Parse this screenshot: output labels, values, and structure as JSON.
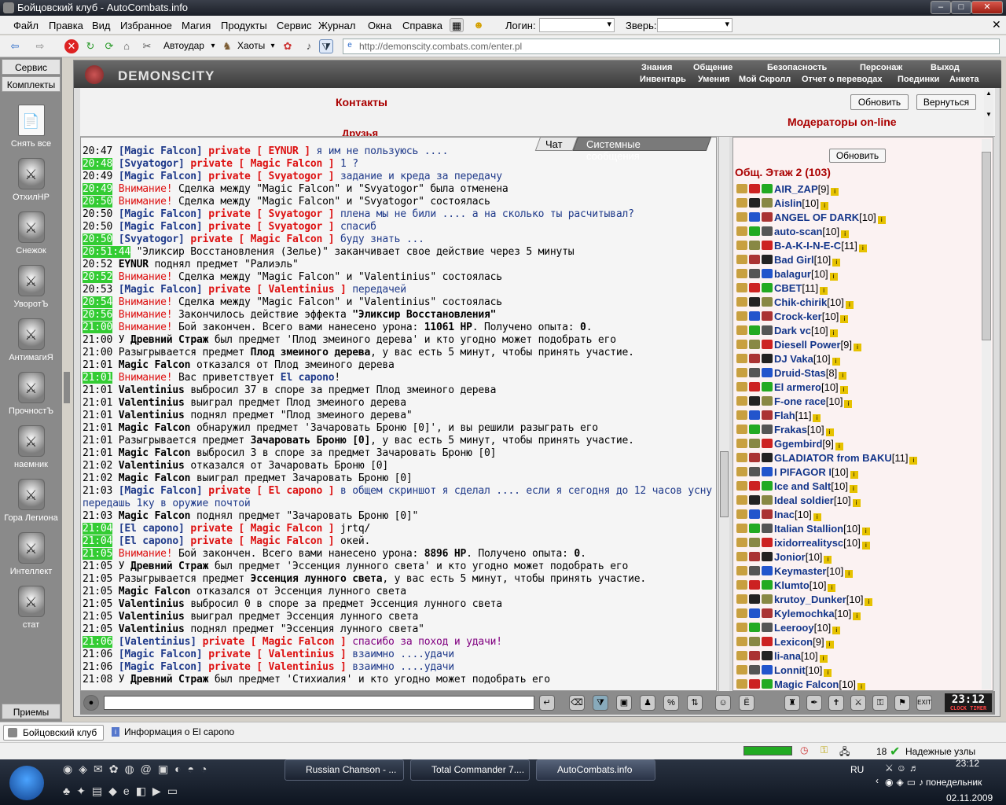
{
  "window": {
    "title": "Бойцовский клуб - AutoCombats.info"
  },
  "menu": {
    "items": [
      "Файл",
      "Правка",
      "Вид",
      "Избранное",
      "Магия",
      "Продукты",
      "Сервис",
      "Журнал",
      "Окна",
      "Справка"
    ],
    "login_label": "Логин:",
    "zver_label": "Зверь:"
  },
  "toolbar": {
    "autoudar": "Автоудар",
    "haoty": "Хаоты",
    "address": "http://demonscity.combats.com/enter.pl"
  },
  "left": {
    "tab1": "Сервис",
    "tab2": "Комплекты",
    "items": [
      "Снять все",
      "ОтхилНР",
      "Снежок",
      "УворотЪ",
      "АнтимагиЯ",
      "ПрочностЪ",
      "наемник",
      "Гора Легиона",
      "Интеллект",
      "стат"
    ],
    "bottom": "Приемы"
  },
  "header": {
    "logo": "DEMONSCITY",
    "nav_top": [
      "Знания",
      "Общение",
      "Безопасность",
      "Персонаж",
      "Выход"
    ],
    "nav_bottom": [
      "Инвентарь",
      "Умения",
      "Мой Скролл",
      "Отчет о переводах",
      "Поединки",
      "Анкета"
    ]
  },
  "contacts": {
    "title": "Контакты",
    "friends": "Друзья",
    "refresh": "Обновить",
    "back": "Вернуться",
    "moderators": "Модераторы on-line"
  },
  "chat_tabs": {
    "chat": "Чат",
    "system": "Системные сообщения"
  },
  "chat": [
    {
      "t": "20:47",
      "g": false,
      "parts": [
        [
          "nick",
          "[Magic Falcon]"
        ],
        [
          "priv",
          " private [ EYNUR ]"
        ],
        [
          "msg-priv",
          " я им не пользуюсь ...."
        ]
      ]
    },
    {
      "t": "20:48",
      "g": true,
      "parts": [
        [
          "nick",
          "[Svyatogor]"
        ],
        [
          "priv",
          " private [ Magic Falcon ]"
        ],
        [
          "msg-priv",
          " 1 ?"
        ]
      ]
    },
    {
      "t": "20:49",
      "g": false,
      "parts": [
        [
          "nick",
          "[Magic Falcon]"
        ],
        [
          "priv",
          " private [ Svyatogor ]"
        ],
        [
          "msg-priv",
          " задание и креда за передачу"
        ]
      ]
    },
    {
      "t": "20:49",
      "g": true,
      "parts": [
        [
          "warn",
          "Внимание!"
        ],
        [
          "msg-sys",
          " Сделка между \"Magic Falcon\" и \"Svyatogor\" была отменена"
        ]
      ]
    },
    {
      "t": "20:50",
      "g": true,
      "parts": [
        [
          "warn",
          "Внимание!"
        ],
        [
          "msg-sys",
          " Сделка между \"Magic Falcon\" и \"Svyatogor\" состоялась"
        ]
      ]
    },
    {
      "t": "20:50",
      "g": false,
      "parts": [
        [
          "nick",
          "[Magic Falcon]"
        ],
        [
          "priv",
          " private [ Svyatogor ]"
        ],
        [
          "msg-priv",
          " плена мы не били .... а на сколько ты расчитывал?"
        ]
      ]
    },
    {
      "t": "20:50",
      "g": false,
      "parts": [
        [
          "nick",
          "[Magic Falcon]"
        ],
        [
          "priv",
          " private [ Svyatogor ]"
        ],
        [
          "msg-priv",
          " спасиб"
        ]
      ]
    },
    {
      "t": "20:50",
      "g": true,
      "parts": [
        [
          "nick",
          "[Svyatogor]"
        ],
        [
          "priv",
          " private [ Magic Falcon ]"
        ],
        [
          "msg-priv",
          " буду знать ..."
        ]
      ]
    },
    {
      "t": "20:51:44",
      "g": true,
      "parts": [
        [
          "msg-sys",
          " \"Эликсир Восстановления (Зелье)\" заканчивает свое действие через 5 минуты"
        ]
      ]
    },
    {
      "t": "20:52",
      "g": false,
      "parts": [
        [
          "bold",
          "EYNUR"
        ],
        [
          "msg-sys",
          " поднял предмет \"Ралиэль\""
        ]
      ]
    },
    {
      "t": "20:52",
      "g": true,
      "parts": [
        [
          "warn",
          "Внимание!"
        ],
        [
          "msg-sys",
          " Сделка между \"Magic Falcon\" и \"Valentinius\" состоялась"
        ]
      ]
    },
    {
      "t": "20:53",
      "g": false,
      "parts": [
        [
          "nick",
          "[Magic Falcon]"
        ],
        [
          "priv",
          " private [ Valentinius ]"
        ],
        [
          "msg-priv",
          " передачей"
        ]
      ]
    },
    {
      "t": "20:54",
      "g": true,
      "parts": [
        [
          "warn",
          "Внимание!"
        ],
        [
          "msg-sys",
          " Сделка между \"Magic Falcon\" и \"Valentinius\" состоялась"
        ]
      ]
    },
    {
      "t": "20:56",
      "g": true,
      "parts": [
        [
          "warn",
          "Внимание!"
        ],
        [
          "msg-sys",
          " Закончилось действие эффекта "
        ],
        [
          "bold",
          "\"Эликсир Восстановления\""
        ]
      ]
    },
    {
      "t": "21:00",
      "g": true,
      "parts": [
        [
          "warn",
          "Внимание!"
        ],
        [
          "msg-sys",
          " Бой закончен. Всего вами нанесено урона: "
        ],
        [
          "bold",
          "11061 HP"
        ],
        [
          "msg-sys",
          ". Получено опыта: "
        ],
        [
          "bold",
          "0"
        ],
        [
          "msg-sys",
          "."
        ]
      ]
    },
    {
      "t": "21:00",
      "g": false,
      "parts": [
        [
          "msg-sys",
          "У "
        ],
        [
          "bold",
          "Древний Страж"
        ],
        [
          "msg-sys",
          " был предмет 'Плод змеиного дерева' и кто угодно может подобрать его"
        ]
      ]
    },
    {
      "t": "21:00",
      "g": false,
      "parts": [
        [
          "msg-sys",
          "Разыгрывается предмет "
        ],
        [
          "bold",
          "Плод змеиного дерева"
        ],
        [
          "msg-sys",
          ", у вас есть 5 минут, чтобы принять участие."
        ]
      ]
    },
    {
      "t": "21:01",
      "g": false,
      "parts": [
        [
          "bold",
          "Magic Falcon"
        ],
        [
          "msg-sys",
          " отказался от Плод змеиного дерева"
        ]
      ]
    },
    {
      "t": "21:01",
      "g": true,
      "parts": [
        [
          "warn",
          "Внимание!"
        ],
        [
          "msg-sys",
          " Вас приветствует "
        ],
        [
          "nick",
          "El capono"
        ],
        [
          "msg-sys",
          "!"
        ]
      ]
    },
    {
      "t": "21:01",
      "g": false,
      "parts": [
        [
          "bold",
          "Valentinius"
        ],
        [
          "msg-sys",
          " выбросил 37 в споре за предмет Плод змеиного дерева"
        ]
      ]
    },
    {
      "t": "21:01",
      "g": false,
      "parts": [
        [
          "bold",
          "Valentinius"
        ],
        [
          "msg-sys",
          " выиграл предмет Плод змеиного дерева"
        ]
      ]
    },
    {
      "t": "21:01",
      "g": false,
      "parts": [
        [
          "bold",
          "Valentinius"
        ],
        [
          "msg-sys",
          " поднял предмет \"Плод змеиного дерева\""
        ]
      ]
    },
    {
      "t": "21:01",
      "g": false,
      "parts": [
        [
          "bold",
          "Magic Falcon"
        ],
        [
          "msg-sys",
          " обнаружил предмет 'Зачаровать Броню [0]', и вы решили разыграть его"
        ]
      ]
    },
    {
      "t": "21:01",
      "g": false,
      "parts": [
        [
          "msg-sys",
          "Разыгрывается предмет "
        ],
        [
          "bold",
          "Зачаровать Броню [0]"
        ],
        [
          "msg-sys",
          ", у вас есть 5 минут, чтобы принять участие."
        ]
      ]
    },
    {
      "t": "21:01",
      "g": false,
      "parts": [
        [
          "bold",
          "Magic Falcon"
        ],
        [
          "msg-sys",
          " выбросил 3 в споре за предмет Зачаровать Броню [0]"
        ]
      ]
    },
    {
      "t": "21:02",
      "g": false,
      "parts": [
        [
          "bold",
          "Valentinius"
        ],
        [
          "msg-sys",
          " отказался от Зачаровать Броню [0]"
        ]
      ]
    },
    {
      "t": "21:02",
      "g": false,
      "parts": [
        [
          "bold",
          "Magic Falcon"
        ],
        [
          "msg-sys",
          " выиграл предмет Зачаровать Броню [0]"
        ]
      ]
    },
    {
      "t": "21:03",
      "g": false,
      "parts": [
        [
          "nick",
          "[Magic Falcon]"
        ],
        [
          "priv",
          " private [ El capono ]"
        ],
        [
          "msg-priv",
          " в общем скриншот я сделал .... если я сегодня до 12 часов усну"
        ]
      ]
    },
    {
      "t": "",
      "g": false,
      "parts": [
        [
          "msg-priv",
          "передашь 1ку в оружие почтой"
        ]
      ]
    },
    {
      "t": "21:03",
      "g": false,
      "parts": [
        [
          "bold",
          "Magic Falcon"
        ],
        [
          "msg-sys",
          " поднял предмет \"Зачаровать Броню [0]\""
        ]
      ]
    },
    {
      "t": "21:04",
      "g": true,
      "parts": [
        [
          "nick",
          "[El capono]"
        ],
        [
          "priv",
          " private [ Magic Falcon ]"
        ],
        [
          "msg-sys",
          " jrtq/"
        ]
      ]
    },
    {
      "t": "21:04",
      "g": true,
      "parts": [
        [
          "nick",
          "[El capono]"
        ],
        [
          "priv",
          " private [ Magic Falcon ]"
        ],
        [
          "msg-sys",
          " окей."
        ]
      ]
    },
    {
      "t": "21:05",
      "g": true,
      "parts": [
        [
          "warn",
          "Внимание!"
        ],
        [
          "msg-sys",
          " Бой закончен. Всего вами нанесено урона: "
        ],
        [
          "bold",
          "8896 HP"
        ],
        [
          "msg-sys",
          ". Получено опыта: "
        ],
        [
          "bold",
          "0"
        ],
        [
          "msg-sys",
          "."
        ]
      ]
    },
    {
      "t": "21:05",
      "g": false,
      "parts": [
        [
          "msg-sys",
          "У "
        ],
        [
          "bold",
          "Древний Страж"
        ],
        [
          "msg-sys",
          " был предмет 'Эссенция лунного света' и кто угодно может подобрать его"
        ]
      ]
    },
    {
      "t": "21:05",
      "g": false,
      "parts": [
        [
          "msg-sys",
          "Разыгрывается предмет "
        ],
        [
          "bold",
          "Эссенция лунного света"
        ],
        [
          "msg-sys",
          ", у вас есть 5 минут, чтобы принять участие."
        ]
      ]
    },
    {
      "t": "21:05",
      "g": false,
      "parts": [
        [
          "bold",
          "Magic Falcon"
        ],
        [
          "msg-sys",
          " отказался от Эссенция лунного света"
        ]
      ]
    },
    {
      "t": "21:05",
      "g": false,
      "parts": [
        [
          "bold",
          "Valentinius"
        ],
        [
          "msg-sys",
          " выбросил 0 в споре за предмет Эссенция лунного света"
        ]
      ]
    },
    {
      "t": "21:05",
      "g": false,
      "parts": [
        [
          "bold",
          "Valentinius"
        ],
        [
          "msg-sys",
          " выиграл предмет Эссенция лунного света"
        ]
      ]
    },
    {
      "t": "21:05",
      "g": false,
      "parts": [
        [
          "bold",
          "Valentinius"
        ],
        [
          "msg-sys",
          " поднял предмет \"Эссенция лунного света\""
        ]
      ]
    },
    {
      "t": "21:06",
      "g": true,
      "parts": [
        [
          "nick",
          "[Valentinius]"
        ],
        [
          "priv",
          " private [ Magic Falcon ]"
        ],
        [
          "purple",
          " спасибо за поход и удачи!"
        ]
      ]
    },
    {
      "t": "21:06",
      "g": false,
      "parts": [
        [
          "nick",
          "[Magic Falcon]"
        ],
        [
          "priv",
          " private [ Valentinius ]"
        ],
        [
          "msg-priv",
          " взаимно ....удачи"
        ]
      ]
    },
    {
      "t": "21:06",
      "g": false,
      "parts": [
        [
          "nick",
          "[Magic Falcon]"
        ],
        [
          "priv",
          " private [ Valentinius ]"
        ],
        [
          "msg-priv",
          " взаимно ....удачи"
        ]
      ]
    },
    {
      "t": "21:08",
      "g": false,
      "parts": [
        [
          "msg-sys",
          "У "
        ],
        [
          "bold",
          "Древний Страж"
        ],
        [
          "msg-sys",
          " был предмет 'Стихиалия' и кто угодно может подобрать его"
        ]
      ]
    }
  ],
  "online": {
    "refresh": "Обновить",
    "title": "Общ. Этаж 2 (103)",
    "users": [
      {
        "n": "AIR_ZAP",
        "l": "[9]"
      },
      {
        "n": "Aislin",
        "l": "[10]"
      },
      {
        "n": "ANGEL OF DARK",
        "l": "[10]"
      },
      {
        "n": "auto-scan",
        "l": "[10]"
      },
      {
        "n": "B-A-K-I-N-E-C",
        "l": "[11]"
      },
      {
        "n": "Bad Girl",
        "l": "[10]"
      },
      {
        "n": "balagur",
        "l": "[10]"
      },
      {
        "n": "CBET",
        "l": "[11]"
      },
      {
        "n": "Chik-chirik",
        "l": "[10]"
      },
      {
        "n": "Crock-ker",
        "l": "[10]"
      },
      {
        "n": "Dark vc",
        "l": "[10]"
      },
      {
        "n": "Diesell Power",
        "l": "[9]"
      },
      {
        "n": "DJ Vaka",
        "l": "[10]"
      },
      {
        "n": "Druid-Stas",
        "l": "[8]"
      },
      {
        "n": "El armero",
        "l": "[10]"
      },
      {
        "n": "F-one race",
        "l": "[10]"
      },
      {
        "n": "Flah",
        "l": "[11]"
      },
      {
        "n": "Frakas",
        "l": "[10]"
      },
      {
        "n": "Ggembird",
        "l": "[9]"
      },
      {
        "n": "GLADIATOR from BAKU",
        "l": "[11]"
      },
      {
        "n": "I PIFAGOR I",
        "l": "[10]"
      },
      {
        "n": "Ice and Salt",
        "l": "[10]"
      },
      {
        "n": "Ideal soldier",
        "l": "[10]"
      },
      {
        "n": "Inac",
        "l": "[10]"
      },
      {
        "n": "Italian Stallion",
        "l": "[10]"
      },
      {
        "n": "ixidorrealitysc",
        "l": "[10]"
      },
      {
        "n": "Jonior",
        "l": "[10]"
      },
      {
        "n": "Keymaster",
        "l": "[10]"
      },
      {
        "n": "Klumto",
        "l": "[10]"
      },
      {
        "n": "krutoy_Dunker",
        "l": "[10]"
      },
      {
        "n": "Kylemochka",
        "l": "[10]"
      },
      {
        "n": "Leerooy",
        "l": "[10]"
      },
      {
        "n": "Lexicon",
        "l": "[9]"
      },
      {
        "n": "li-ana",
        "l": "[10]"
      },
      {
        "n": "Lonnit",
        "l": "[10]"
      },
      {
        "n": "Magic Falcon",
        "l": "[10]"
      }
    ]
  },
  "clock": {
    "time": "23:12",
    "sub1": "CLOCK",
    "sub2": "TIMER"
  },
  "tabs": {
    "tab1": "Бойцовский клуб",
    "tab2": "Информация о El capono"
  },
  "status": {
    "count": "18",
    "label": "Надежные узлы"
  },
  "taskbar": {
    "tasks": [
      "Russian Chanson - ...",
      "Total Commander 7....",
      "AutoCombats.info"
    ],
    "lang": "RU",
    "time": "23:12",
    "day": "понедельник",
    "date": "02.11.2009"
  }
}
